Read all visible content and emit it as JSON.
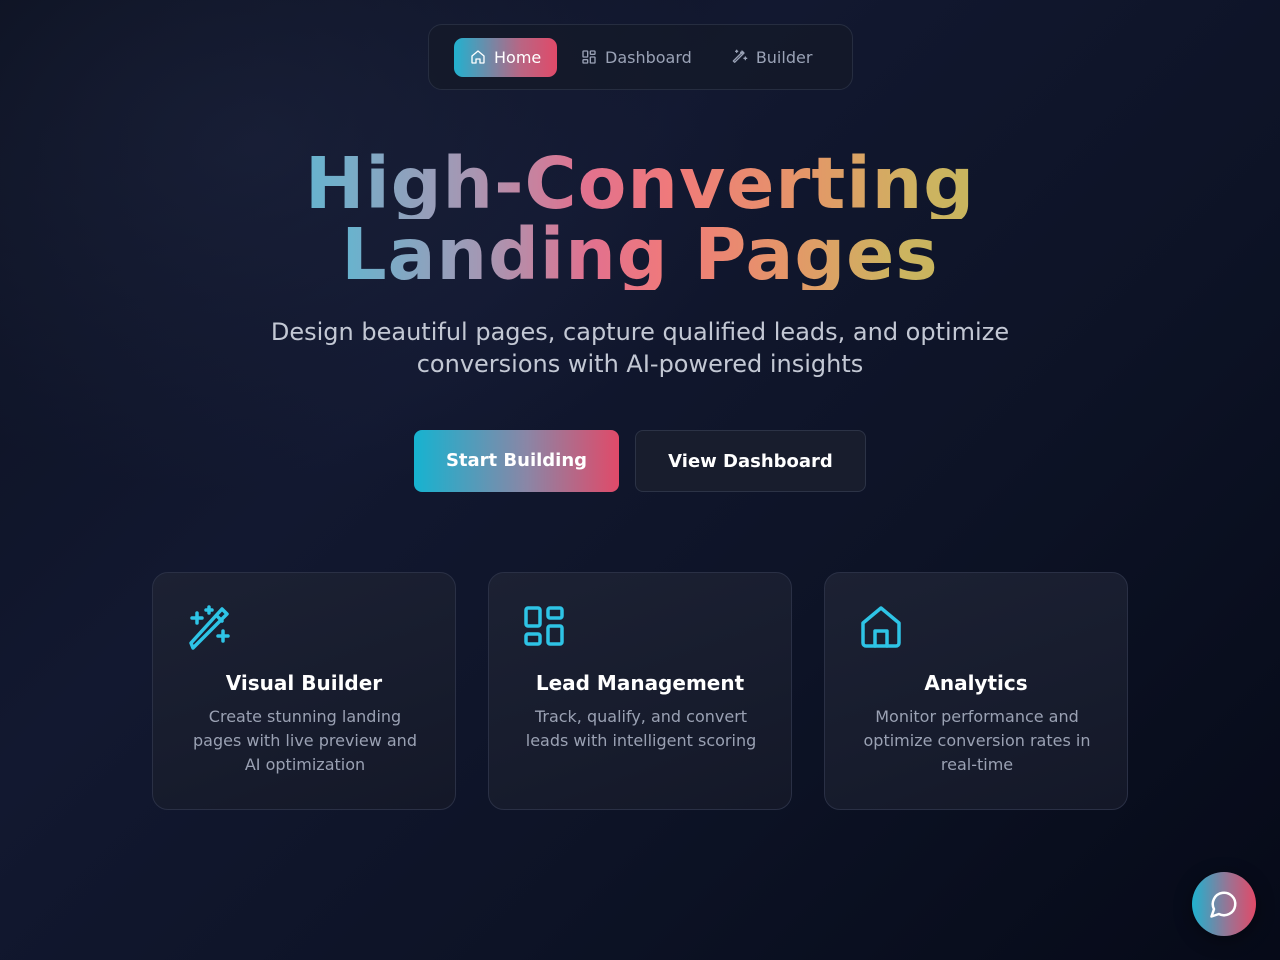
{
  "nav": {
    "items": [
      {
        "label": "Home",
        "icon": "home-icon",
        "active": true
      },
      {
        "label": "Dashboard",
        "icon": "dashboard-icon",
        "active": false
      },
      {
        "label": "Builder",
        "icon": "magic-wand-icon",
        "active": false
      }
    ]
  },
  "hero": {
    "title_line1": "High-Converting",
    "title_line2": "Landing Pages",
    "subtitle_line1": "Design beautiful pages, capture qualified leads, and optimize",
    "subtitle_line2": "conversions with AI-powered insights"
  },
  "cta": {
    "primary_label": "Start Building",
    "secondary_label": "View Dashboard"
  },
  "features": [
    {
      "title": "Visual Builder",
      "description": "Create stunning landing pages with live preview and AI optimization",
      "icon": "magic-wand-icon"
    },
    {
      "title": "Lead Management",
      "description": "Track, qualify, and convert leads with intelligent scoring",
      "icon": "dashboard-icon"
    },
    {
      "title": "Analytics",
      "description": "Monitor performance and optimize conversion rates in real-time",
      "icon": "home-icon"
    }
  ],
  "chat": {
    "icon": "chat-bubble-icon"
  },
  "colors": {
    "accent_cyan": "#22b1cf",
    "accent_pink": "#e04a69",
    "icon_cyan": "#2ec4e6",
    "background": "#0c1120"
  }
}
